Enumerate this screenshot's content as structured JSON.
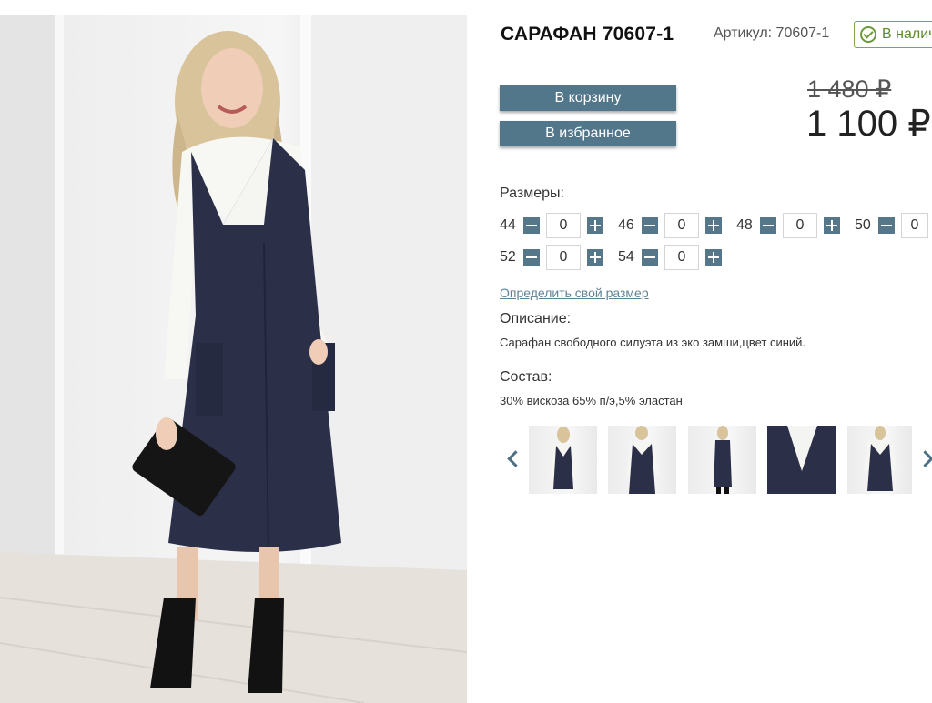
{
  "product": {
    "title": "САРАФАН 70607-1",
    "sku": "Артикул: 70607-1",
    "stock": "В наличии",
    "old_price": "1 480 ₽",
    "new_price": "1 100 ₽"
  },
  "buttons": {
    "cart": "В корзину",
    "favorite": "В избранное"
  },
  "sizes": {
    "label": "Размеры:",
    "items": [
      {
        "size": "44",
        "qty": "0"
      },
      {
        "size": "46",
        "qty": "0"
      },
      {
        "size": "48",
        "qty": "0"
      },
      {
        "size": "50",
        "qty": "0"
      },
      {
        "size": "52",
        "qty": "0"
      },
      {
        "size": "54",
        "qty": "0"
      }
    ],
    "link": "Определить свой размер"
  },
  "description": {
    "label": "Описание:",
    "text": "Сарафан свободного силуэта из эко замши,цвет синий."
  },
  "composition": {
    "label": "Состав:",
    "text": "30% вискоза 65% п/э,5% эластан"
  },
  "thumbnails": {
    "count": 5,
    "icons": [
      "chevron-left-icon",
      "chevron-right-icon"
    ]
  },
  "colors": {
    "button": "#52768a",
    "stock_border": "#7fa64a",
    "link": "#5e8396",
    "dress": "#2b2f48"
  }
}
